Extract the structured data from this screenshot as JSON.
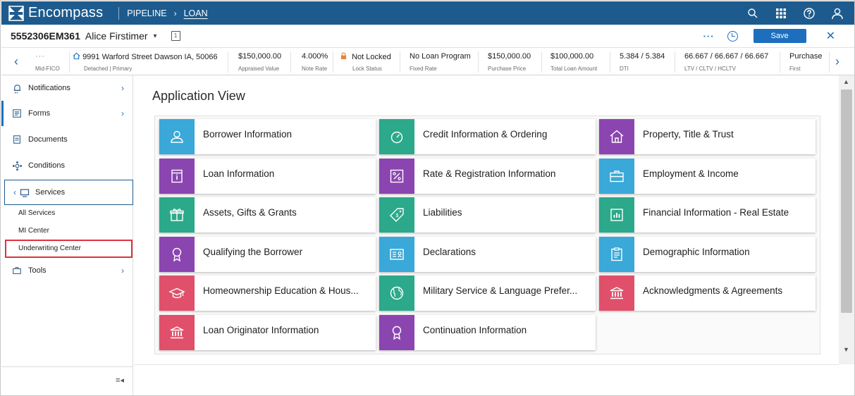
{
  "app": {
    "name": "Encompass"
  },
  "nav": {
    "pipeline": "PIPELINE",
    "chevron": "›",
    "loan": "LOAN"
  },
  "loan": {
    "number": "5552306EM361",
    "borrower": "Alice Firstimer",
    "borrower_chevron": "▾"
  },
  "actions": {
    "more": "···",
    "save": "Save",
    "close": "✕"
  },
  "summary": {
    "prev_arrow": "‹",
    "next_arrow": "›",
    "fico": {
      "value": "···",
      "label": "Mid-FICO"
    },
    "address": {
      "value": "9991 Warford Street Dawson IA, 50066",
      "label": "Detached | Primary"
    },
    "appraised": {
      "value": "$150,000.00",
      "label": "Appraised Value"
    },
    "note_rate": {
      "value": "4.000%",
      "label": "Note Rate"
    },
    "lock": {
      "value": "Not Locked",
      "label": "Lock Status"
    },
    "program": {
      "value": "No Loan Program",
      "label": "Fixed Rate"
    },
    "purchase_price": {
      "value": "$150,000.00",
      "label": "Purchase Price"
    },
    "total_loan": {
      "value": "$100,000.00",
      "label": "Total Loan Amount"
    },
    "dti": {
      "value": "5.384 / 5.384",
      "label": "DTI"
    },
    "ltv": {
      "value": "66.667 / 66.667 / 66.667",
      "label": "LTV / CLTV / HCLTV"
    },
    "purpose": {
      "value": "Purchase",
      "label": "First"
    }
  },
  "sidebar": {
    "notifications": "Notifications",
    "forms": "Forms",
    "documents": "Documents",
    "conditions": "Conditions",
    "services": "Services",
    "sub": [
      "All Services",
      "MI Center",
      "Underwriting Center"
    ],
    "tools": "Tools",
    "arrow": "›",
    "back": "‹",
    "collapse": "≡◂"
  },
  "main": {
    "title": "Application View",
    "tiles": [
      {
        "label": "Borrower Information",
        "icon": "person-icon",
        "color": "#3aa8d8"
      },
      {
        "label": "Credit Information & Ordering",
        "icon": "gauge-icon",
        "color": "#2ba98a"
      },
      {
        "label": "Property, Title & Trust",
        "icon": "house-icon",
        "color": "#8b45b0"
      },
      {
        "label": "Loan Information",
        "icon": "info-doc-icon",
        "color": "#8b45b0"
      },
      {
        "label": "Rate & Registration Information",
        "icon": "percent-icon",
        "color": "#8b45b0"
      },
      {
        "label": "Employment & Income",
        "icon": "briefcase-icon",
        "color": "#3aa8d8"
      },
      {
        "label": "Assets, Gifts & Grants",
        "icon": "gift-icon",
        "color": "#2ba98a"
      },
      {
        "label": "Liabilities",
        "icon": "price-tag-icon",
        "color": "#2ba98a"
      },
      {
        "label": "Financial Information - Real Estate",
        "icon": "chart-icon",
        "color": "#2ba98a"
      },
      {
        "label": "Qualifying the Borrower",
        "icon": "ribbon-icon",
        "color": "#8b45b0"
      },
      {
        "label": "Declarations",
        "icon": "id-card-icon",
        "color": "#3aa8d8"
      },
      {
        "label": "Demographic Information",
        "icon": "clipboard-icon",
        "color": "#3aa8d8"
      },
      {
        "label": "Homeownership Education & Hous...",
        "icon": "graduation-cap-icon",
        "color": "#e0506b"
      },
      {
        "label": "Military Service & Language Prefer...",
        "icon": "globe-icon",
        "color": "#2ba98a"
      },
      {
        "label": "Acknowledgments & Agreements",
        "icon": "bank-icon",
        "color": "#e0506b"
      },
      {
        "label": "Loan Originator Information",
        "icon": "bank-icon",
        "color": "#e0506b"
      },
      {
        "label": "Continuation Information",
        "icon": "ribbon-icon",
        "color": "#8b45b0"
      }
    ]
  },
  "scrollbar": {
    "up": "▲",
    "down": "▼"
  }
}
